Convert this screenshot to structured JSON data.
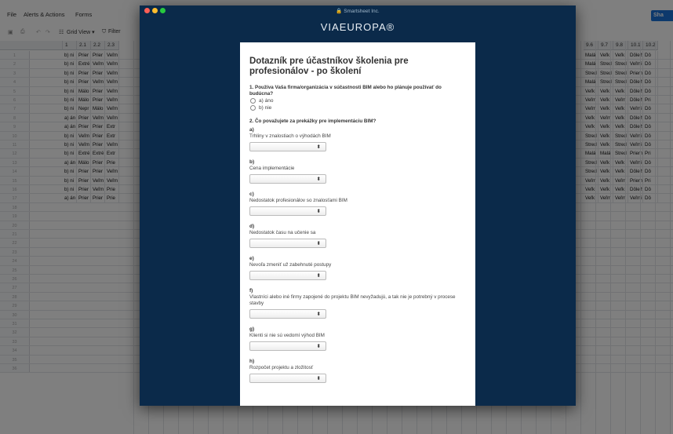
{
  "menu": {
    "file": "File",
    "alerts": "Alerts & Actions",
    "forms": "Forms",
    "share": "Sha"
  },
  "toolbar": {
    "grid_view": "Grid View ▾",
    "filter": "Filter"
  },
  "columns_left": [
    "1",
    "2.1",
    "2.2",
    "2.3"
  ],
  "columns_right": [
    "9.6",
    "9.7",
    "9.8",
    "10.1",
    "10.2"
  ],
  "rows_left": [
    [
      "b) ni",
      "Prier",
      "Prier",
      "Veľm"
    ],
    [
      "b) ni",
      "Extré",
      "Veľm",
      "Veľm"
    ],
    [
      "b) ni",
      "Prier",
      "Prier",
      "Veľm"
    ],
    [
      "b) ni",
      "Prier",
      "Veľm",
      "Veľm"
    ],
    [
      "b) ni",
      "Málo",
      "Prier",
      "Veľm"
    ],
    [
      "b) ni",
      "Málo",
      "Prier",
      "Veľm"
    ],
    [
      "b) ni",
      "Nepr",
      "Málo",
      "Veľm"
    ],
    [
      "a) án",
      "Prier",
      "Veľm",
      "Veľm"
    ],
    [
      "a) án",
      "Prier",
      "Prier",
      "Extr"
    ],
    [
      "b) ni",
      "Veľm",
      "Prier",
      "Extr"
    ],
    [
      "b) ni",
      "Veľm",
      "Prier",
      "Veľm"
    ],
    [
      "b) ni",
      "Extré",
      "Extré",
      "Extr"
    ],
    [
      "a) án",
      "Málo",
      "Prier",
      "Prie"
    ],
    [
      "b) ni",
      "Prier",
      "Prier",
      "Veľm"
    ],
    [
      "b) ni",
      "Prier",
      "Veľm",
      "Veľm"
    ],
    [
      "b) ni",
      "Prier",
      "Veľm",
      "Prie"
    ],
    [
      "a) án",
      "Prier",
      "Prier",
      "Prie"
    ]
  ],
  "rows_right": [
    [
      "Malá",
      "Veľk",
      "Veľk",
      "Dôlež",
      "Dô"
    ],
    [
      "Malá",
      "Stred",
      "Stred",
      "Veľmi",
      "Dô"
    ],
    [
      "Stred",
      "Stred",
      "Stred",
      "Priem",
      "Dô"
    ],
    [
      "Malá",
      "Stred",
      "Stred",
      "Dôlež",
      "Dô"
    ],
    [
      "Veľk",
      "Veľk",
      "Veľk",
      "Dôlež",
      "Dô"
    ],
    [
      "Veľm",
      "Veľk",
      "Veľm",
      "Dôlež",
      "Pri"
    ],
    [
      "Veľm",
      "Veľk",
      "Veľk",
      "Veľmi",
      "Dô"
    ],
    [
      "Veľk",
      "Veľm",
      "Veľk",
      "Dôlež",
      "Dô"
    ],
    [
      "Veľk",
      "Veľk",
      "Veľk",
      "Dôlež",
      "Dô"
    ],
    [
      "Stred",
      "Veľk",
      "Stred",
      "Veľmi",
      "Dô"
    ],
    [
      "Stred",
      "Veľk",
      "Stred",
      "Veľmi",
      "Dô"
    ],
    [
      "Malá",
      "Malá",
      "Stred",
      "Priem",
      "Pri"
    ],
    [
      "Stred",
      "Veľk",
      "Veľk",
      "Veľmi",
      "Dô"
    ],
    [
      "Stred",
      "Veľk",
      "Veľk",
      "Dôlež",
      "Dô"
    ],
    [
      "Veľm",
      "Veľk",
      "Veľm",
      "Priem",
      "Pri"
    ],
    [
      "Veľk",
      "Veľk",
      "Veľk",
      "Dôlež",
      "Dô"
    ],
    [
      "Veľk",
      "Veľm",
      "Veľm",
      "Veľmi",
      "Dô"
    ]
  ],
  "row_count": 36,
  "window": {
    "title": "Smartsheet Inc.",
    "logo": "VIAEUROPA®"
  },
  "form": {
    "title": "Dotazník pre účastníkov školenia pre profesionálov - po školení",
    "q1": "1. Používa Vaša firma/organizácia v súčastnosti BIM alebo ho plánuje používať do budúcna?",
    "q1_options": [
      "a) áno",
      "b) nie"
    ],
    "q2": "2. Čo považujete za prekážky pre implementáciu BIM?",
    "q2_items": [
      {
        "letter": "a)",
        "text": "Trhliny v znalostiach o výhodách BIM"
      },
      {
        "letter": "b)",
        "text": "Cena implementácie"
      },
      {
        "letter": "c)",
        "text": "Nedostatok profesionálov so znalosťami BIM"
      },
      {
        "letter": "d)",
        "text": "Nedostatok času na učenie sa"
      },
      {
        "letter": "e)",
        "text": "Nevoľa zmeniť už zabehnuté postupy"
      },
      {
        "letter": "f)",
        "text": "Vlastníci alebo iné firmy zapojené do projektu BIM nevyžadujú, a tak nie je potrebný v procese stavby"
      },
      {
        "letter": "g)",
        "text": "Klienti si nie sú vedomí výhod BIM"
      },
      {
        "letter": "h)",
        "text": "Rozpočet projektu a zložitosť"
      }
    ],
    "select_arrow": "⬍"
  },
  "colors": {
    "overlay": "rgba(0,0,0,0.5)",
    "window": "#0b2a4a",
    "share": "#1a73d9"
  }
}
